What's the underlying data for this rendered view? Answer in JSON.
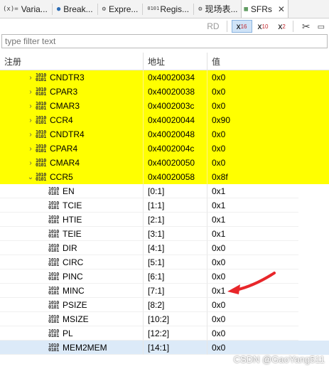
{
  "tabs": [
    {
      "icon": "(x)=",
      "label": "Varia..."
    },
    {
      "icon": "●",
      "label": "Break..."
    },
    {
      "icon": "⚙",
      "label": "Expre..."
    },
    {
      "icon": "0101",
      "label": "Regis..."
    },
    {
      "icon": "⚙",
      "label": "现场表..."
    },
    {
      "icon": "▦",
      "label": "SFRs",
      "active": true
    }
  ],
  "toolbar": {
    "rd": "RD",
    "x16": "x",
    "x16_sub": "16",
    "x10": "x",
    "x10_sub": "10",
    "x2": "x",
    "x2_sub": "2"
  },
  "filter": {
    "placeholder": "type filter text"
  },
  "columns": {
    "name": "注册",
    "address": "地址",
    "value": "值"
  },
  "registers": [
    {
      "name": "CNDTR3",
      "address": "0x40020034",
      "value": "0x0",
      "expanded": false
    },
    {
      "name": "CPAR3",
      "address": "0x40020038",
      "value": "0x0",
      "expanded": false
    },
    {
      "name": "CMAR3",
      "address": "0x4002003c",
      "value": "0x0",
      "expanded": false
    },
    {
      "name": "CCR4",
      "address": "0x40020044",
      "value": "0x90",
      "expanded": false
    },
    {
      "name": "CNDTR4",
      "address": "0x40020048",
      "value": "0x0",
      "expanded": false
    },
    {
      "name": "CPAR4",
      "address": "0x4002004c",
      "value": "0x0",
      "expanded": false
    },
    {
      "name": "CMAR4",
      "address": "0x40020050",
      "value": "0x0",
      "expanded": false
    },
    {
      "name": "CCR5",
      "address": "0x40020058",
      "value": "0x8f",
      "expanded": true
    }
  ],
  "fields": [
    {
      "name": "EN",
      "bits": "[0:1]",
      "value": "0x1"
    },
    {
      "name": "TCIE",
      "bits": "[1:1]",
      "value": "0x1"
    },
    {
      "name": "HTIE",
      "bits": "[2:1]",
      "value": "0x1"
    },
    {
      "name": "TEIE",
      "bits": "[3:1]",
      "value": "0x1"
    },
    {
      "name": "DIR",
      "bits": "[4:1]",
      "value": "0x0"
    },
    {
      "name": "CIRC",
      "bits": "[5:1]",
      "value": "0x0"
    },
    {
      "name": "PINC",
      "bits": "[6:1]",
      "value": "0x0"
    },
    {
      "name": "MINC",
      "bits": "[7:1]",
      "value": "0x1"
    },
    {
      "name": "PSIZE",
      "bits": "[8:2]",
      "value": "0x0"
    },
    {
      "name": "MSIZE",
      "bits": "[10:2]",
      "value": "0x0"
    },
    {
      "name": "PL",
      "bits": "[12:2]",
      "value": "0x0"
    },
    {
      "name": "MEM2MEM",
      "bits": "[14:1]",
      "value": "0x0",
      "selected": true
    }
  ],
  "icon_text": {
    "top": "1010",
    "bottom": "0101"
  },
  "watermark": "CSDN @GaoYang511",
  "colors": {
    "highlight": "#ffff00",
    "selection": "#dceaf8",
    "arrow": "#e8262a"
  }
}
